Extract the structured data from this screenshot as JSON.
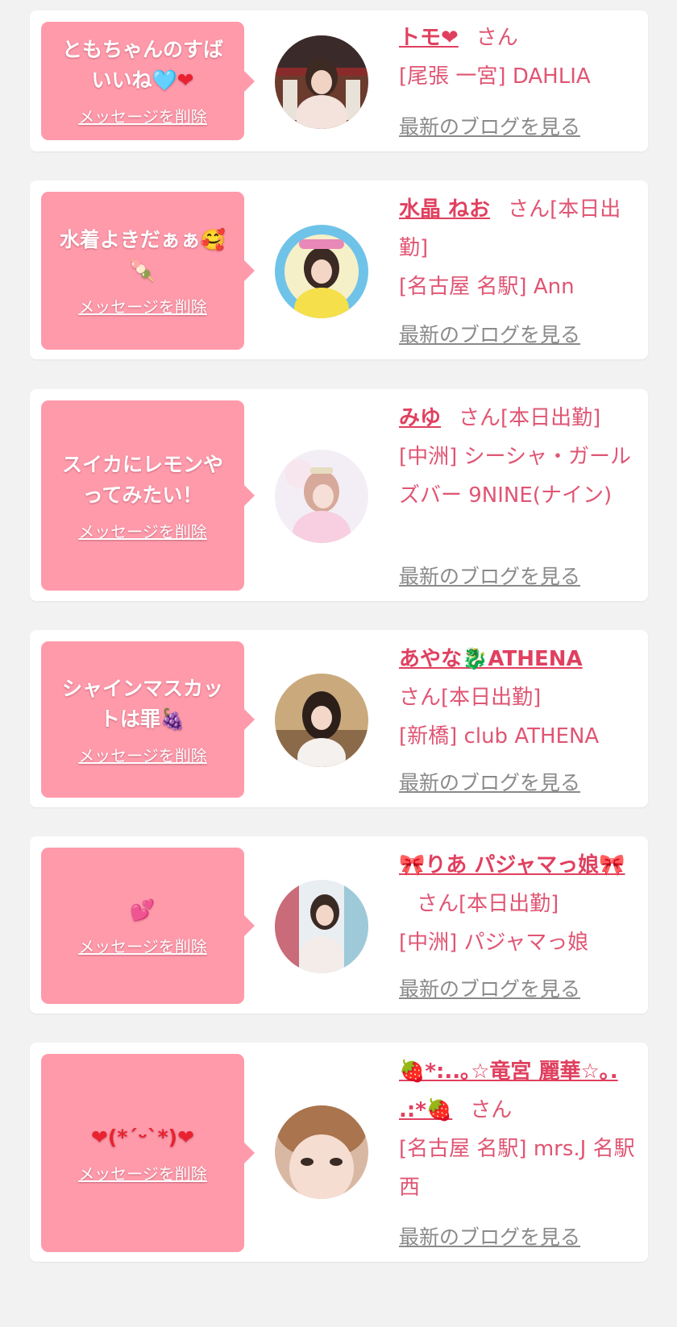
{
  "cards": [
    {
      "message_lines": [
        "ともちゃんのすば",
        "いいね"
      ],
      "message_emoji": [
        "🩵",
        "❤"
      ],
      "delete_label": "メッセージを削除",
      "name": "トモ❤",
      "honorific": "さん",
      "status": "",
      "shop": "[尾張 一宮] DAHLIA",
      "blog_label": "最新のブログを見る"
    },
    {
      "message_lines": [
        "水着よきだぁぁ🥰",
        "🍡"
      ],
      "delete_label": "メッセージを削除",
      "name": "水晶 ねお",
      "honorific": "さん",
      "status": "[本日出勤]",
      "shop": "[名古屋 名駅] Ann",
      "blog_label": "最新のブログを見る"
    },
    {
      "message_lines": [
        "スイカにレモンや",
        "ってみたい！"
      ],
      "delete_label": "メッセージを削除",
      "name": "みゆ",
      "honorific": "さん",
      "status": "[本日出勤]",
      "shop": "[中洲] シーシャ・ガールズバー 9NINE(ナイン)",
      "blog_label": "最新のブログを見る"
    },
    {
      "message_lines": [
        "シャインマスカッ",
        "トは罪🍇"
      ],
      "delete_label": "メッセージを削除",
      "name": "あやな🐉ATHENA",
      "honorific": "さん",
      "status": "[本日出勤]",
      "shop": "[新橋] club ATHENA",
      "blog_label": "最新のブログを見る"
    },
    {
      "message_lines": [
        "💕"
      ],
      "delete_label": "メッセージを削除",
      "name": "🎀りあ パジャマっ娘🎀",
      "honorific": "さん",
      "status": "[本日出勤]",
      "shop": "[中洲] パジャマっ娘",
      "blog_label": "最新のブログを見る"
    },
    {
      "message_lines": [
        "❤(*´ᵕ`*)❤"
      ],
      "delete_label": "メッセージを削除",
      "name": "🍓*:..｡☆竜宮 麗華☆｡. .:*🍓",
      "honorific": "さん",
      "status": "",
      "shop": "[名古屋 名駅] mrs.J 名駅西",
      "blog_label": "最新のブログを見る"
    }
  ],
  "colors": {
    "background": "#f2f2f2",
    "bubble": "#ff9aab",
    "name": "#e0405f",
    "text": "#e05573",
    "link_gray": "#8a8a8a"
  }
}
